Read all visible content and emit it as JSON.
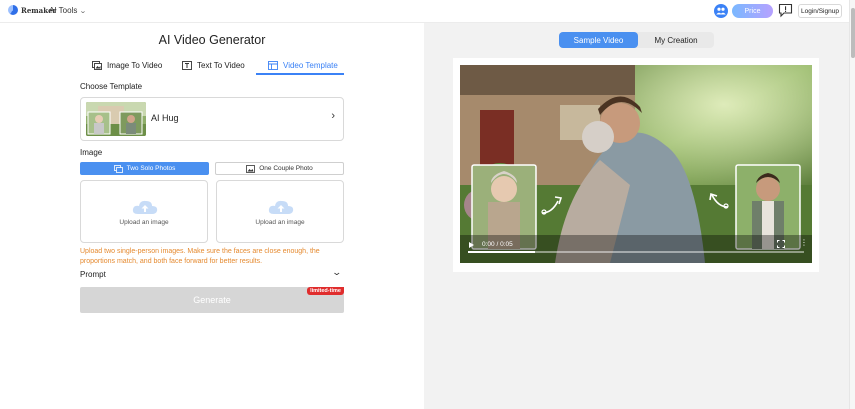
{
  "header": {
    "logo_text": "Remaker",
    "ai_tools_label": "AI Tools",
    "price_label": "Price",
    "login_label": "Login/Signup"
  },
  "main": {
    "title": "AI Video Generator",
    "tabs": [
      {
        "label": "Image To Video",
        "icon": "image-icon",
        "active": false
      },
      {
        "label": "Text To Video",
        "icon": "text-icon",
        "active": false
      },
      {
        "label": "Video Template",
        "icon": "template-icon",
        "active": true
      }
    ],
    "choose_template_label": "Choose Template",
    "template": {
      "name": "AI Hug"
    },
    "image_label": "Image",
    "image_options": [
      {
        "label": "Two Solo Photos",
        "active": true
      },
      {
        "label": "One Couple Photo",
        "active": false
      }
    ],
    "upload_boxes": [
      {
        "label": "Upload an image"
      },
      {
        "label": "Upload an image"
      }
    ],
    "hint": "Upload two single-person images. Make sure the faces are close enough, the proportions match, and both face forward for better results.",
    "prompt_label": "Prompt",
    "generate_label": "Generate",
    "limited_badge": "limited-time"
  },
  "preview": {
    "tabs": [
      {
        "label": "Sample Video",
        "active": true
      },
      {
        "label": "My Creation",
        "active": false
      }
    ],
    "video": {
      "time": "0:00 / 0:05",
      "progress": 0.2
    }
  },
  "colors": {
    "accent": "#4a90f0",
    "hint": "#e58a30",
    "badge": "#e02d2d"
  }
}
